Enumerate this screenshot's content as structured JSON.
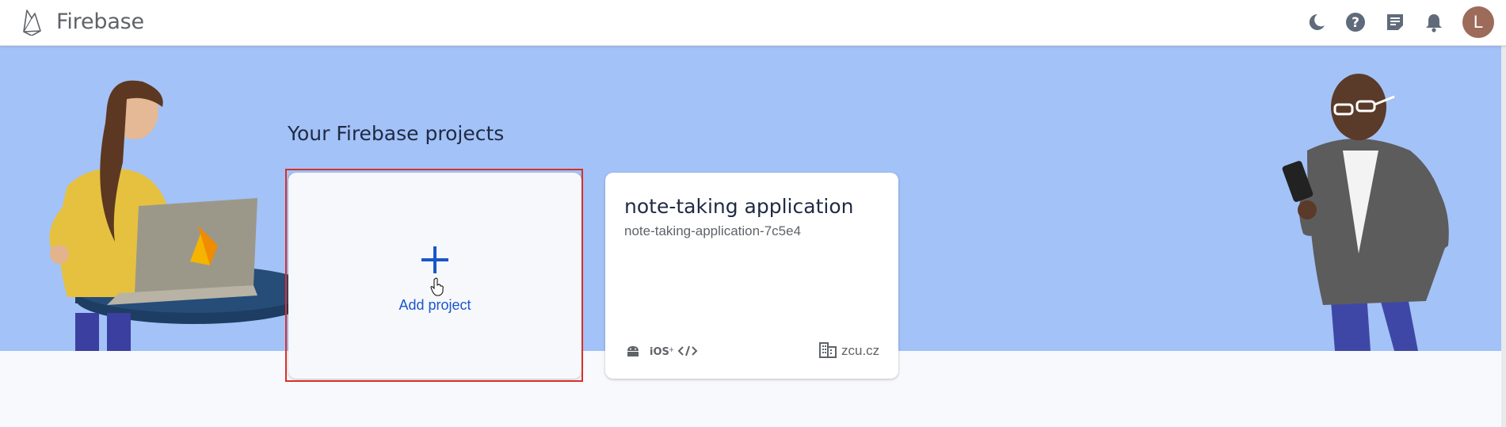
{
  "header": {
    "brand": "Firebase",
    "avatar_initial": "L",
    "icons": [
      "firebase-logo-icon",
      "dark-mode-icon",
      "help-icon",
      "release-notes-icon",
      "notifications-icon"
    ]
  },
  "main": {
    "section_title": "Your Firebase projects",
    "add_project_label": "Add project",
    "projects": [
      {
        "name": "note-taking application",
        "id": "note-taking-application-7c5e4",
        "platforms": [
          "android-icon",
          "ios-icon",
          "web-icon"
        ],
        "organization": "zcu.cz"
      }
    ]
  },
  "colors": {
    "hero_bg": "#a3c2f7",
    "accent_blue": "#1a56c9",
    "highlight_red": "#d93025",
    "avatar_bg": "#9c6b5a"
  }
}
